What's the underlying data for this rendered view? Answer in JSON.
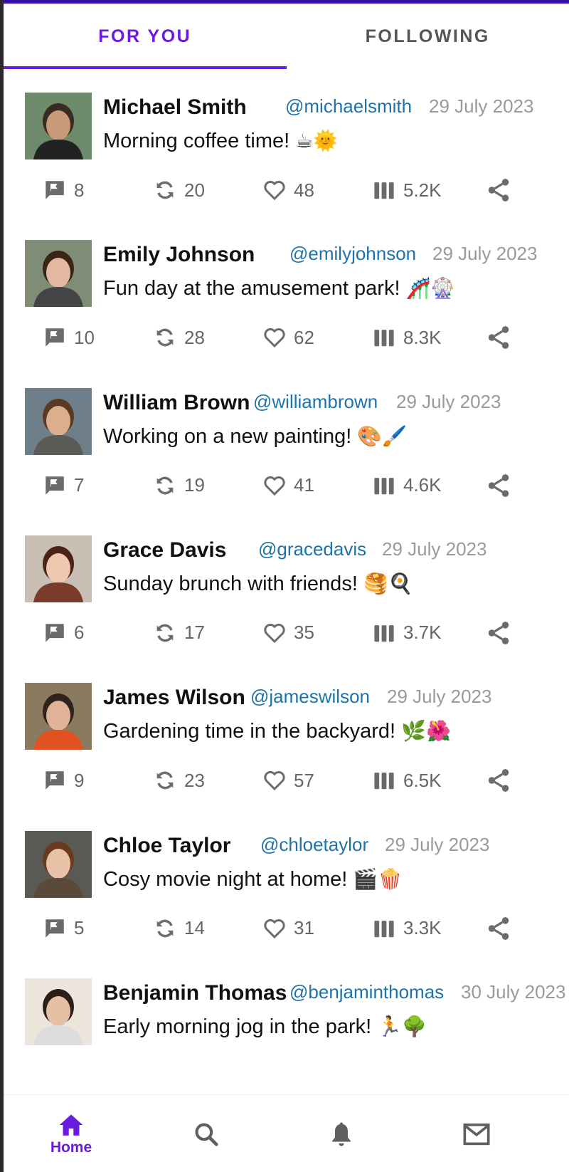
{
  "tabs": {
    "for_you": "FOR YOU",
    "following": "FOLLOWING"
  },
  "colors": {
    "accent": "#6a1be0",
    "handle": "#1e73a8",
    "muted": "#9a9a9a",
    "icon": "#6b6b6b"
  },
  "posts": [
    {
      "name": "Michael Smith",
      "handle": "@michaelsmith",
      "date": "29 July 2023",
      "text": "Morning coffee time!",
      "emoji": "☕🌞",
      "comments": "8",
      "reposts": "20",
      "likes": "48",
      "views": "5.2K"
    },
    {
      "name": "Emily Johnson",
      "handle": "@emilyjohnson",
      "date": "29 July 2023",
      "text": "Fun day at the amusement park!",
      "emoji": "🎢🎡",
      "comments": "10",
      "reposts": "28",
      "likes": "62",
      "views": "8.3K"
    },
    {
      "name": "William Brown",
      "handle": "@williambrown",
      "date": "29 July 2023",
      "text": "Working on a new painting!",
      "emoji": "🎨🖌️",
      "comments": "7",
      "reposts": "19",
      "likes": "41",
      "views": "4.6K"
    },
    {
      "name": "Grace Davis",
      "handle": "@gracedavis",
      "date": "29 July 2023",
      "text": "Sunday brunch with friends!",
      "emoji": "🥞🍳",
      "comments": "6",
      "reposts": "17",
      "likes": "35",
      "views": "3.7K"
    },
    {
      "name": "James Wilson",
      "handle": "@jameswilson",
      "date": "29 July 2023",
      "text": "Gardening time in the backyard!",
      "emoji": "🌿🌺",
      "comments": "9",
      "reposts": "23",
      "likes": "57",
      "views": "6.5K"
    },
    {
      "name": "Chloe Taylor",
      "handle": "@chloetaylor",
      "date": "29 July 2023",
      "text": "Cosy movie night at home!",
      "emoji": "🎬🍿",
      "comments": "5",
      "reposts": "14",
      "likes": "31",
      "views": "3.3K"
    },
    {
      "name": "Benjamin Thomas",
      "handle": "@benjaminthomas",
      "date": "30 July 2023",
      "text": "Early morning jog in the park!",
      "emoji": "🏃🌳",
      "comments": "",
      "reposts": "",
      "likes": "",
      "views": ""
    }
  ],
  "nav": {
    "home_label": "Home",
    "items": [
      "home-icon",
      "search-icon",
      "bell-icon",
      "mail-icon"
    ]
  }
}
